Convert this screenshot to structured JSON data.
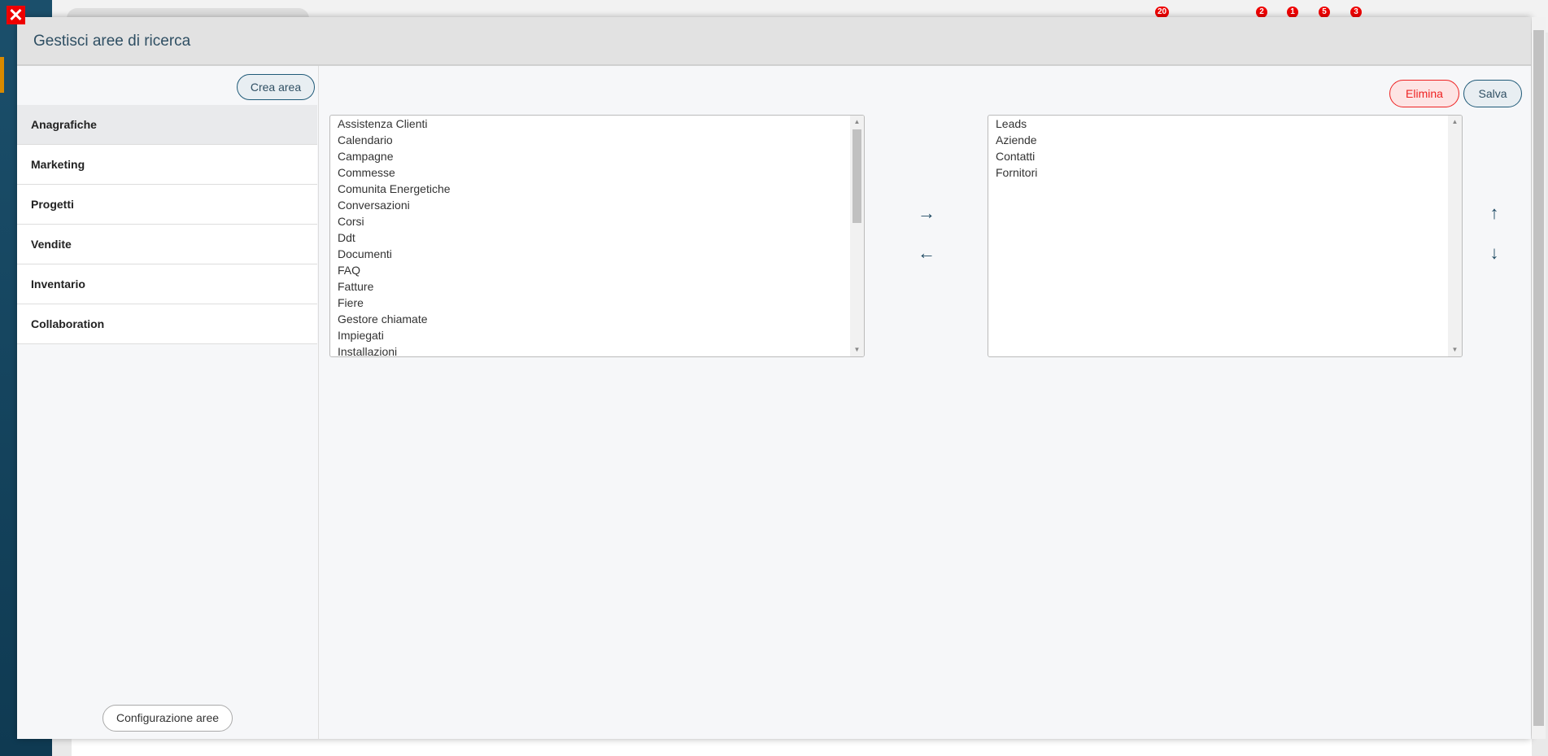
{
  "background": {
    "badges": [
      "20",
      "2",
      "1",
      "5",
      "3"
    ]
  },
  "modal": {
    "title": "Gestisci aree di ricerca",
    "create_area_label": "Crea area",
    "config_areas_label": "Configurazione aree",
    "delete_label": "Elimina",
    "save_label": "Salva",
    "areas": [
      "Anagrafiche",
      "Marketing",
      "Progetti",
      "Vendite",
      "Inventario",
      "Collaboration"
    ],
    "active_area": "Anagrafiche",
    "available": [
      "Assistenza Clienti",
      "Calendario",
      "Campagne",
      "Commesse",
      "Comunita Energetiche",
      "Conversazioni",
      "Corsi",
      "Ddt",
      "Documenti",
      "FAQ",
      "Fatture",
      "Fiere",
      "Gestore chiamate",
      "Impiegati",
      "Installazioni"
    ],
    "selected": [
      "Leads",
      "Aziende",
      "Contatti",
      "Fornitori"
    ]
  },
  "colors": {
    "accent": "#1f5a78",
    "danger": "#e22222",
    "badge": "#e00000"
  }
}
